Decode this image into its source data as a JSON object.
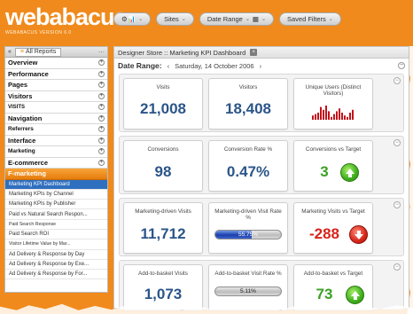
{
  "app": {
    "logo": "webabacus",
    "version": "WEBABACUS VERSION 6.0"
  },
  "toolbar": {
    "settings_label": "⚙📊",
    "sites_label": "Sites",
    "date_range_label": "Date Range",
    "table_label": "▦",
    "saved_filters_label": "Saved Filters",
    "dropdown_glyph": "⌄"
  },
  "sidebar": {
    "tab_label": "All Reports",
    "sections": [
      {
        "label": "Overview"
      },
      {
        "label": "Performance"
      },
      {
        "label": "Pages"
      },
      {
        "label": "Visitors"
      },
      {
        "label": "VISITS"
      },
      {
        "label": "Navigation"
      },
      {
        "label": "Referrers"
      },
      {
        "label": "Interface"
      },
      {
        "label": "Marketing"
      },
      {
        "label": "E-commerce"
      }
    ],
    "active_section": "F-marketing",
    "items": [
      {
        "label": "Marketing KPI Dashboard"
      },
      {
        "label": "Marketing KPIs by Channel"
      },
      {
        "label": "Marketing KPIs by Publisher"
      },
      {
        "label": "Paid vs Natural Search Respon..."
      },
      {
        "label": "Paid Search Response"
      },
      {
        "label": "Paid Search ROI"
      },
      {
        "label": "Visitor Lifetime Value by Mar..."
      },
      {
        "label": "Ad Delivery & Response by Day"
      },
      {
        "label": "Ad Delivery & Response by Exe..."
      },
      {
        "label": "Ad Delivery & Response by For..."
      }
    ]
  },
  "main": {
    "breadcrumb": "Designer Store :: Marketing KPI Dashboard",
    "date_range_label": "Date Range:",
    "date_prev": "‹",
    "date_value": "Saturday, 14 October 2006",
    "date_next": "›"
  },
  "kpis": {
    "visits": {
      "title": "Visits",
      "value": "21,008"
    },
    "visitors": {
      "title": "Visitors",
      "value": "18,408"
    },
    "unique_users": {
      "title": "Unique Users (Distinct Visitors)",
      "spark": [
        3,
        4,
        5,
        9,
        7,
        10,
        6,
        2,
        4,
        6,
        8,
        5,
        3,
        2,
        5,
        7
      ]
    },
    "conversions": {
      "title": "Conversions",
      "value": "98"
    },
    "conversion_rate": {
      "title": "Conversion Rate %",
      "value": "0.47%"
    },
    "conversions_vs_target": {
      "title": "Conversions vs Target",
      "value": "3",
      "direction": "up"
    },
    "mkt_visits": {
      "title": "Marketing-driven Visits",
      "value": "11,712"
    },
    "mkt_visit_rate": {
      "title": "Marketing-driven Visit Rate %",
      "value": "55.75%",
      "fraction": 0.5575
    },
    "mkt_vs_target": {
      "title": "Marketing Visits vs Target",
      "value": "-288",
      "direction": "down"
    },
    "atb_visits": {
      "title": "Add-to-basket Visits",
      "value": "1,073"
    },
    "atb_visit_rate": {
      "title": "Add-to-basket Visit Rate %",
      "value": "5.11%",
      "fraction": 0.0511
    },
    "atb_vs_target": {
      "title": "Add-to-basket vs Target",
      "value": "73",
      "direction": "up"
    }
  },
  "colors": {
    "brand": "#f08a1c",
    "value_blue": "#2b5589",
    "value_green": "#3aa224",
    "value_red": "#d8221a",
    "selected_item": "#2f6fbf"
  }
}
